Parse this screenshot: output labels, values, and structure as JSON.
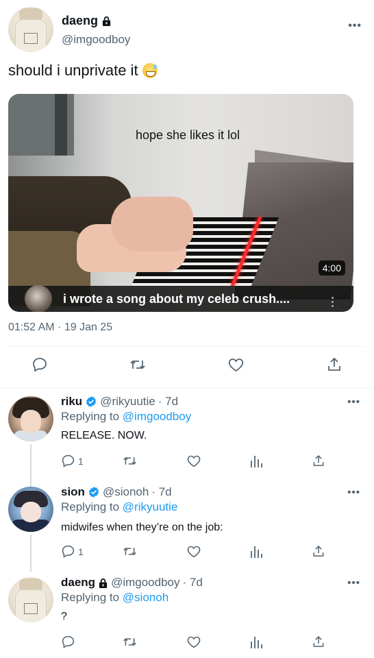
{
  "main_tweet": {
    "display_name": "daeng",
    "handle": "@imgoodboy",
    "text": "should i unprivate it",
    "video": {
      "caption": "hope she likes it lol",
      "duration": "4:00",
      "title": "i wrote a song about my celeb crush...."
    },
    "timestamp": "01:52 AM · 19 Jan 25"
  },
  "replies": [
    {
      "display_name": "riku",
      "handle": "@rikyuutie",
      "age": "· 7d",
      "replying_label": "Replying to",
      "replying_to": "@imgoodboy",
      "text": "RELEASE. NOW.",
      "reply_count": "1",
      "verified": true
    },
    {
      "display_name": "sion",
      "handle": "@sionoh",
      "age": "· 7d",
      "replying_label": "Replying to",
      "replying_to": "@rikyuutie",
      "text": "midwifes when they’re on the job:",
      "reply_count": "1",
      "verified": true
    },
    {
      "display_name": "daeng",
      "handle": "@imgoodboy",
      "age": "· 7d",
      "replying_label": "Replying to",
      "replying_to": "@sionoh",
      "text": "?",
      "reply_count": "",
      "verified": false
    }
  ],
  "colors": {
    "accent": "#1d9bf0",
    "muted": "#536471",
    "text": "#0f1419",
    "divider": "#eff3f4"
  },
  "icons": [
    "lock-icon",
    "more-icon",
    "reply-icon",
    "retweet-icon",
    "like-icon",
    "share-icon",
    "views-icon",
    "verified-icon"
  ]
}
